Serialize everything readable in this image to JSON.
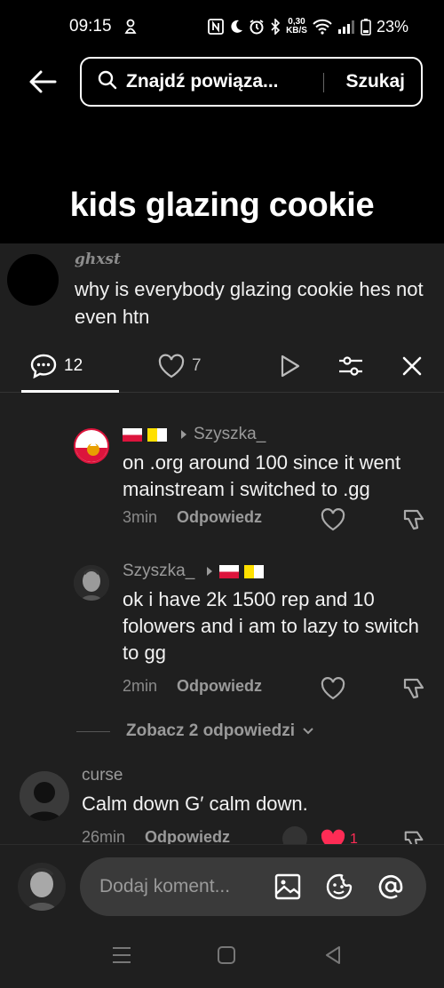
{
  "status": {
    "time": "09:15",
    "net_speed": "0,30",
    "net_unit": "KB/S",
    "battery": "23%"
  },
  "search": {
    "query": "Znajdź powiąza...",
    "submit": "Szukaj"
  },
  "video": {
    "title": "kids glazing cookie"
  },
  "op_comment": {
    "username": "ghxst",
    "text": "why is everybody glazing cookie hes not even htn"
  },
  "toolbar": {
    "comments_count": "12",
    "likes_count": "7"
  },
  "replies": [
    {
      "username": "Szyszka_",
      "text": "on .org around 100 since it went mainstream i switched to .gg",
      "time": "3min",
      "reply_label": "Odpowiedz"
    },
    {
      "username": "Szyszka_",
      "text": "ok i have 2k 1500 rep and 10 folowers and i am to lazy to switch to gg",
      "time": "2min",
      "reply_label": "Odpowiedz"
    }
  ],
  "see_more": {
    "label": "Zobacz 2 odpowiedzi"
  },
  "comment3": {
    "username": "curse",
    "text": "Calm down G′ calm down.",
    "time": "26min",
    "reply_label": "Odpowiedz",
    "likes": "1"
  },
  "composer": {
    "placeholder": "Dodaj koment..."
  },
  "colors": {
    "accent_red": "#fe2c55",
    "panel_bg": "#1f1f1f"
  }
}
